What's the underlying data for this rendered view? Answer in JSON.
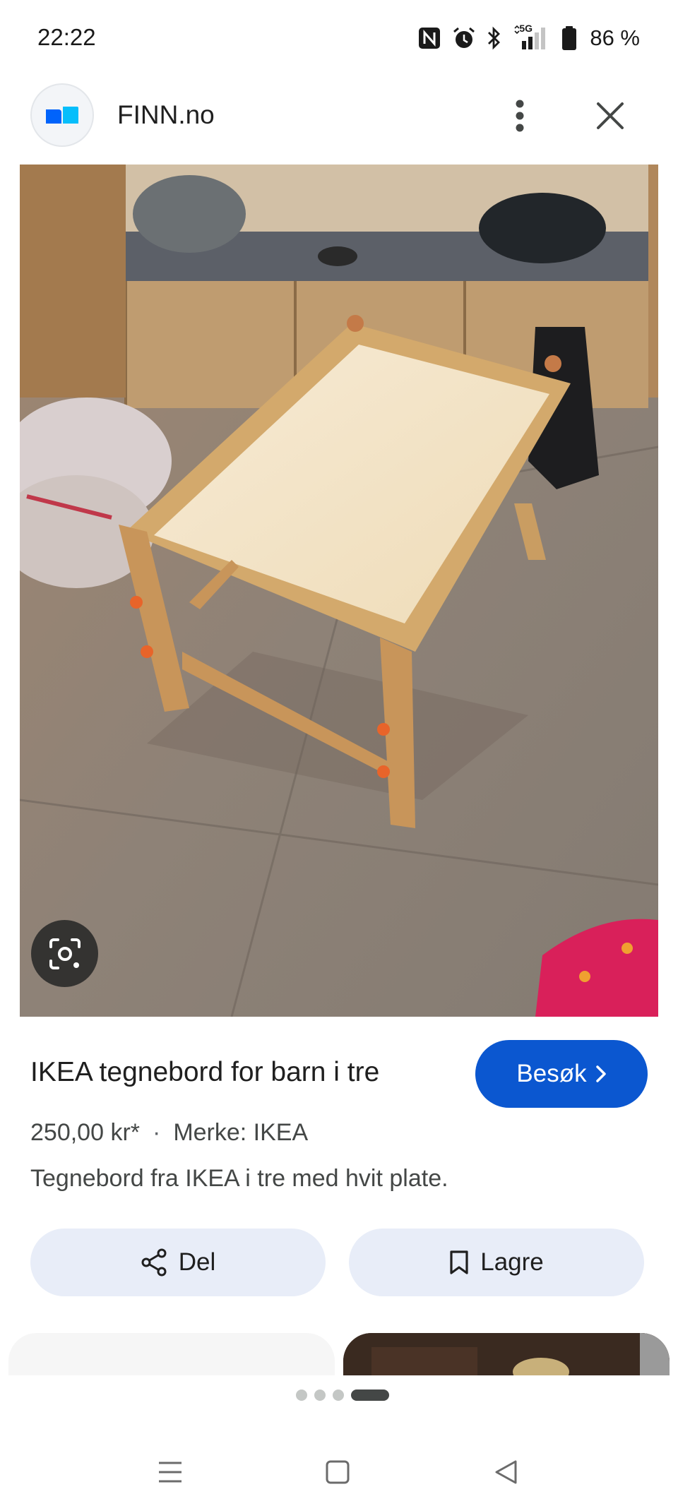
{
  "status_bar": {
    "time": "22:22",
    "network": "5G",
    "battery_percent": "86 %",
    "battery_level": 0.86,
    "icons": [
      "nfc-icon",
      "alarm-icon",
      "bluetooth-icon",
      "signal-icon",
      "battery-icon"
    ]
  },
  "header": {
    "site_name": "FINN.no",
    "logo_colors": [
      "#0063fb",
      "#06befb"
    ],
    "more_icon": "more-vert-icon",
    "close_icon": "close-icon"
  },
  "result": {
    "title": "IKEA tegnebord for barn i tre",
    "visit_label": "Besøk",
    "price": "250,00 kr*",
    "separator": "·",
    "brand": "Merke: IKEA",
    "description": "Tegnebord fra IKEA i tre med hvit plate.",
    "share_label": "Del",
    "save_label": "Lagre"
  },
  "page_indicator": {
    "count": 4,
    "active_index": 3
  },
  "colors": {
    "accent": "#0b57d0",
    "chip_bg": "#e8edf8",
    "text": "#1f1f1f",
    "muted": "#444746"
  }
}
